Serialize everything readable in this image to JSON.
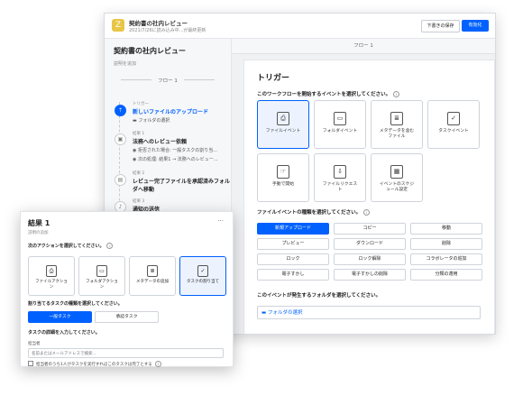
{
  "header": {
    "app_icon": "Z",
    "title": "契約書の社内レビュー",
    "subtitle": "2021/7/26に読み込み中...が最終更新",
    "save_draft": "下書きの保存",
    "enable": "有効化"
  },
  "sidebar": {
    "title": "契約書の社内レビュー",
    "description": "説明を追加",
    "flow_label": "フロー 1",
    "steps": [
      {
        "small": "トリガー",
        "title": "新しいファイルのアップロード",
        "sub": [
          "フォルダの選択"
        ]
      },
      {
        "small": "結果 1",
        "title": "法務へのレビュー依頼",
        "sub": [
          "拒否された場合: 一般タスクの割り当...",
          "次の処理: 結果1 → 法務へのレビュー..."
        ]
      },
      {
        "small": "結果 2",
        "title": "レビュー完了ファイルを承認済みフォル",
        "title2": "ダへ移動",
        "sub": []
      },
      {
        "small": "結果 3",
        "title": "通知の送信",
        "sub": []
      }
    ]
  },
  "main": {
    "flow_label": "フロー 1",
    "title": "トリガー",
    "q_event": "このワークフローを開始するイベントを選択してください。",
    "events": [
      {
        "label": "ファイルイベント",
        "icon": "file-event-icon",
        "glyph": "⎙",
        "selected": true
      },
      {
        "label": "フォルダイベント",
        "icon": "folder-event-icon",
        "glyph": "▭",
        "selected": false
      },
      {
        "label": "メタデータを含む",
        "label2": "ファイル",
        "icon": "metadata-file-icon",
        "glyph": "≣",
        "selected": false
      },
      {
        "label": "タスクイベント",
        "icon": "task-event-icon",
        "glyph": "✓",
        "selected": false
      },
      {
        "label": "手動で開始",
        "icon": "manual-start-icon",
        "glyph": "☞",
        "selected": false
      },
      {
        "label": "ファイルリクエス",
        "label2": "ト",
        "icon": "file-request-icon",
        "glyph": "⇩",
        "selected": false
      },
      {
        "label": "イベントのスケジ",
        "label2": "ュール設定",
        "icon": "schedule-icon",
        "glyph": "▦",
        "selected": false
      }
    ],
    "q_type": "ファイルイベントの種類を選択してください。",
    "types": [
      "新規アップロード",
      "コピー",
      "移動",
      "プレビュー",
      "ダウンロード",
      "削除",
      "ロック",
      "ロック解除",
      "コラボレータの追加",
      "電子すかし",
      "電子すかしの削除",
      "分類の適用"
    ],
    "q_folder": "このイベントが発生するフォルダを選択してください。",
    "folder_select": "フォルダの選択"
  },
  "panel": {
    "title": "結果 1",
    "more": "···",
    "description": "説明の追加",
    "q_action": "次のアクションを選択してください。",
    "actions": [
      {
        "label": "ファイルアクショ",
        "label2": "ン",
        "icon": "file-action-icon",
        "glyph": "⎙",
        "selected": false
      },
      {
        "label": "フォルダアクショ",
        "label2": "ン",
        "icon": "folder-action-icon",
        "glyph": "▭",
        "selected": false
      },
      {
        "label": "メタデータの追加",
        "icon": "metadata-add-icon",
        "glyph": "≣",
        "selected": false
      },
      {
        "label": "タスクの割り当て",
        "icon": "task-assign-icon",
        "glyph": "✓",
        "selected": true
      }
    ],
    "q_task_type": "割り当てるタスクの種類を選択してください。",
    "task_types": [
      {
        "label": "一般タスク",
        "selected": true
      },
      {
        "label": "承認タスク",
        "selected": false
      }
    ],
    "q_task_detail": "タスクの詳細を入力してください。",
    "assignee_label": "担当者",
    "assignee_placeholder": "名前またはメールアドレスで検索...",
    "checkbox_label": "担当者のうち1人がタスクを実行すればこのタスクは完了とする"
  },
  "colors": {
    "accent": "#0061fe",
    "app_icon": "#e8c545"
  }
}
